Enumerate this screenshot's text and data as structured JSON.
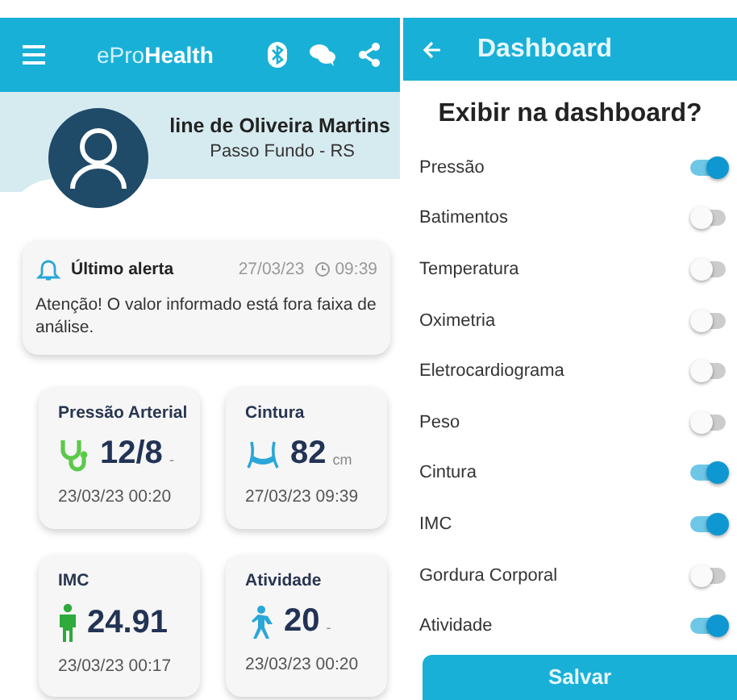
{
  "left": {
    "header": {
      "logo_light": "ePro",
      "logo_bold": "Health"
    },
    "profile": {
      "name": "line de Oliveira Martins",
      "location": "Passo Fundo - RS"
    },
    "alert": {
      "title": "Último alerta",
      "date": "27/03/23",
      "time": "09:39",
      "message": "Atenção! O valor informado está fora faixa de análise."
    },
    "metrics": [
      {
        "kind": "stethoscope",
        "title": "Pressão Arterial",
        "value": "12/8",
        "unit": "-",
        "date": "23/03/23 00:20"
      },
      {
        "kind": "waist",
        "title": "Cintura",
        "value": "82",
        "unit": "cm",
        "date": "27/03/23 09:39"
      },
      {
        "kind": "person",
        "title": "IMC",
        "value": "24.91",
        "date": "23/03/23 00:17"
      },
      {
        "kind": "walking",
        "title": "Atividade",
        "value": "20",
        "unit": "-",
        "date": "23/03/23 00:20"
      }
    ]
  },
  "right": {
    "header": {
      "title": "Dashboard"
    },
    "heading": "Exibir na dashboard?",
    "toggles": [
      {
        "label": "Pressão",
        "on": true
      },
      {
        "label": "Batimentos",
        "on": false
      },
      {
        "label": "Temperatura",
        "on": false
      },
      {
        "label": "Oximetria",
        "on": false
      },
      {
        "label": "Eletrocardiograma",
        "on": false
      },
      {
        "label": "Peso",
        "on": false
      },
      {
        "label": "Cintura",
        "on": true
      },
      {
        "label": "IMC",
        "on": true
      },
      {
        "label": "Gordura Corporal",
        "on": false
      },
      {
        "label": "Atividade",
        "on": true
      }
    ],
    "save_button": "Salvar"
  }
}
